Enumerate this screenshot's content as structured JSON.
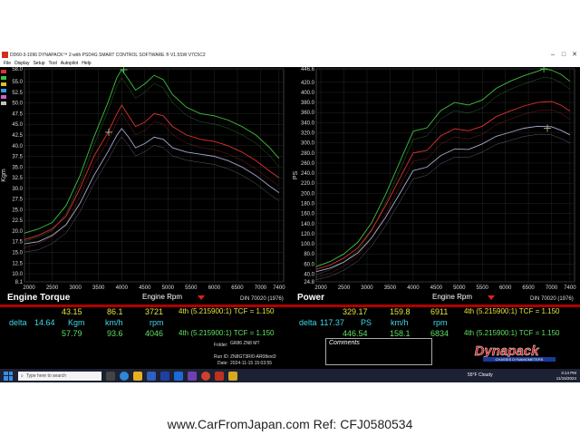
{
  "window": {
    "title": "DD60-3-1096 DYNAPACK™ 2-with PSD4G SMART CONTROL SOFTWARE ® V1.5SW V7C5C2",
    "menu": [
      "File",
      "Display",
      "Setup",
      "Tool",
      "Autopilot",
      "Help"
    ]
  },
  "legend_colors": [
    "#e03030",
    "#40c040",
    "#e0c020",
    "#30a0e0",
    "#d060d0",
    "#c0c0c0"
  ],
  "chart_data": [
    {
      "type": "line",
      "title": "Engine Torque",
      "xlabel": "Engine Rpm",
      "ylabel": "Kgm",
      "din": "DIN 70020 (1976)",
      "xlim": [
        1900,
        7500
      ],
      "ylim": [
        8.1,
        58.0
      ],
      "x_ticks": [
        "2000",
        "2500",
        "3000",
        "3500",
        "4000",
        "4500",
        "5000",
        "5500",
        "6000",
        "6500",
        "7000",
        "7400"
      ],
      "y_ticks": [
        "58.0",
        "55.0",
        "52.5",
        "50.0",
        "47.5",
        "45.0",
        "42.5",
        "40.0",
        "37.5",
        "35.0",
        "32.5",
        "30.0",
        "27.5",
        "25.0",
        "22.5",
        "20.0",
        "17.5",
        "15.0",
        "12.5",
        "10.0",
        "8.1"
      ],
      "series": [
        {
          "color": "#40c040",
          "x": [
            1900,
            2200,
            2500,
            2800,
            3100,
            3400,
            3700,
            3900,
            4000,
            4150,
            4300,
            4500,
            4700,
            4900,
            5100,
            5400,
            5700,
            6000,
            6300,
            6600,
            6900,
            7200,
            7400
          ],
          "y": [
            19.5,
            20.5,
            22.0,
            26.0,
            33.0,
            42.0,
            50.0,
            56.0,
            57.8,
            55.5,
            53.0,
            54.5,
            56.5,
            55.5,
            52.0,
            49.0,
            47.5,
            47.0,
            46.0,
            44.5,
            42.5,
            39.5,
            37.0
          ]
        },
        {
          "color": "#e03030",
          "x": [
            1900,
            2200,
            2500,
            2800,
            3100,
            3400,
            3700,
            3900,
            4000,
            4150,
            4300,
            4500,
            4700,
            4900,
            5100,
            5400,
            5700,
            6000,
            6300,
            6600,
            6900,
            7200,
            7400
          ],
          "y": [
            18.0,
            19.0,
            20.5,
            23.5,
            30.0,
            37.5,
            43.0,
            47.5,
            49.5,
            47.0,
            44.5,
            45.5,
            47.5,
            47.0,
            44.5,
            42.5,
            41.5,
            41.0,
            40.0,
            38.5,
            36.5,
            34.0,
            32.5
          ]
        },
        {
          "color": "#a8a8d0",
          "x": [
            1900,
            2200,
            2500,
            2800,
            3100,
            3400,
            3700,
            3900,
            4000,
            4150,
            4300,
            4500,
            4700,
            4900,
            5100,
            5400,
            5700,
            6000,
            6300,
            6600,
            6900,
            7200,
            7400
          ],
          "y": [
            17.0,
            17.5,
            19.0,
            21.5,
            26.5,
            33.0,
            38.5,
            42.5,
            44.0,
            42.0,
            39.5,
            40.5,
            42.0,
            41.5,
            39.5,
            38.5,
            38.0,
            37.5,
            36.5,
            35.0,
            33.0,
            30.5,
            29.0
          ]
        }
      ],
      "markers": [
        {
          "x": 3721,
          "y": 43.15,
          "color": "#c8c8a0"
        },
        {
          "x": 4046,
          "y": 57.79,
          "color": "#60e060"
        }
      ]
    },
    {
      "type": "line",
      "title": "Power",
      "xlabel": "Engine Rpm",
      "ylabel": "PS",
      "din": "DIN 70020 (1976)",
      "xlim": [
        1900,
        7500
      ],
      "ylim": [
        24.8,
        446.6
      ],
      "x_ticks": [
        "2000",
        "2500",
        "3000",
        "3500",
        "4000",
        "4500",
        "5000",
        "5500",
        "6000",
        "6500",
        "7000",
        "7400"
      ],
      "y_ticks": [
        "446.6",
        "420.0",
        "400.0",
        "380.0",
        "360.0",
        "340.0",
        "320.0",
        "300.0",
        "280.0",
        "260.0",
        "240.0",
        "220.0",
        "200.0",
        "180.0",
        "160.0",
        "140.0",
        "120.0",
        "100.0",
        "80.0",
        "60.0",
        "40.0",
        "24.8"
      ],
      "series": [
        {
          "color": "#40c040",
          "x": [
            1900,
            2200,
            2500,
            2800,
            3100,
            3400,
            3700,
            4000,
            4300,
            4600,
            4900,
            5200,
            5500,
            5800,
            6100,
            6400,
            6700,
            6834,
            7000,
            7200,
            7400
          ],
          "y": [
            55,
            65,
            80,
            103,
            142,
            197,
            260,
            323,
            330,
            364,
            380,
            375,
            385,
            408,
            422,
            433,
            442,
            446.5,
            444,
            436,
            422
          ]
        },
        {
          "color": "#e03030",
          "x": [
            1900,
            2200,
            2500,
            2800,
            3100,
            3400,
            3700,
            4000,
            4300,
            4600,
            4900,
            5200,
            5500,
            5800,
            6100,
            6400,
            6700,
            7000,
            7200,
            7400
          ],
          "y": [
            50,
            58,
            72,
            92,
            128,
            175,
            228,
            280,
            285,
            314,
            328,
            324,
            333,
            352,
            363,
            373,
            380,
            382,
            375,
            363
          ]
        },
        {
          "color": "#a8a8d0",
          "x": [
            1900,
            2200,
            2500,
            2800,
            3100,
            3400,
            3700,
            4000,
            4300,
            4600,
            4900,
            5200,
            5500,
            5800,
            6100,
            6400,
            6700,
            7000,
            7200,
            7400
          ],
          "y": [
            45,
            52,
            64,
            82,
            112,
            152,
            198,
            245,
            252,
            275,
            288,
            287,
            298,
            313,
            321,
            329,
            333,
            332,
            325,
            316
          ]
        }
      ],
      "markers": [
        {
          "x": 6911,
          "y": 329.17,
          "color": "#c8c8a0"
        },
        {
          "x": 6834,
          "y": 446.54,
          "color": "#60e060"
        }
      ]
    }
  ],
  "torque_readout": {
    "row1": {
      "value": "43.15",
      "speed": "86.1",
      "rpm": "3721",
      "gear": "4th (5.215900:1) TCF = 1.150"
    },
    "delta_label": "delta",
    "delta_value": "14.64",
    "unit": "Kgm",
    "speed_unit": "km/h",
    "rpm_unit": "rpm",
    "row3": {
      "value": "57.79",
      "speed": "93.6",
      "rpm": "4046",
      "gear": "4th (5.215900:1) TCF = 1.150"
    }
  },
  "power_readout": {
    "row1": {
      "value": "329.17",
      "speed": "159.8",
      "rpm": "6911",
      "gear": "4th (5.215900:1) TCF = 1.150"
    },
    "delta_label": "delta",
    "delta_value": "117.37",
    "unit": "PS",
    "speed_unit": "km/h",
    "rpm_unit": "rpm",
    "row3": {
      "value": "446.54",
      "speed": "158.1",
      "rpm": "6834",
      "gear": "4th (5.215900:1) TCF = 1.150"
    }
  },
  "run_info": {
    "folder_label": "Folder:",
    "folder_value": "GR86 ZN8 MT",
    "runid_label": "Run ID:",
    "runid_value": "ZN8GT3R/0-AR08ext3",
    "date_label": "Date:",
    "date_value": "2024-11-15 15:03:55"
  },
  "comments_label": "Comments",
  "logo": {
    "name": "Dynapack",
    "tagline": "CHASSIS DYNAMOMETERS"
  },
  "taskbar": {
    "search_placeholder": "Type here to search",
    "weather": "55°F  Cloudy",
    "time": "3:14 PM",
    "date": "11/15/2024"
  },
  "watermark": "www.CarFromJapan.com Ref: CFJ0580534"
}
